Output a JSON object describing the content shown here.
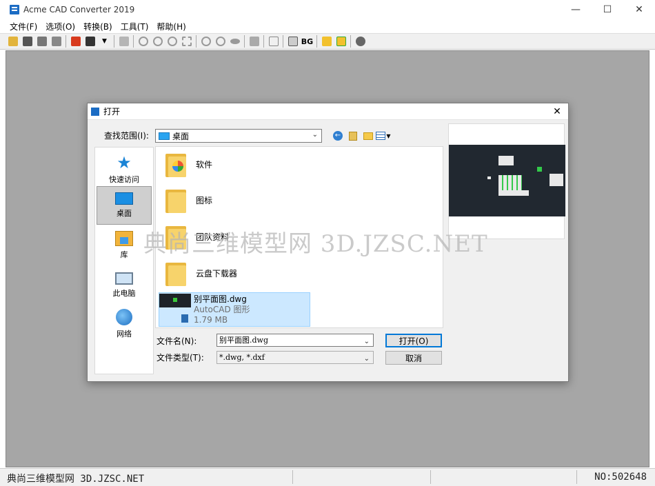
{
  "app": {
    "title": "Acme CAD Converter 2019",
    "controls": {
      "minimize": "—",
      "maximize": "☐",
      "close": "✕"
    }
  },
  "menu": [
    "文件(F)",
    "选项(O)",
    "转换(B)",
    "工具(T)",
    "帮助(H)"
  ],
  "toolbar": {
    "bg_label": "BG"
  },
  "dialog": {
    "title": "打开",
    "close": "✕",
    "look_in_label": "查找范围(I):",
    "look_in_value": "桌面",
    "places": [
      {
        "label": "快速访问",
        "icon": "star-icon"
      },
      {
        "label": "桌面",
        "icon": "desktop-icon"
      },
      {
        "label": "库",
        "icon": "library-icon"
      },
      {
        "label": "此电脑",
        "icon": "computer-icon"
      },
      {
        "label": "网络",
        "icon": "network-icon"
      }
    ],
    "files": [
      {
        "name": "软件",
        "type": "folder"
      },
      {
        "name": "图标",
        "type": "folder"
      },
      {
        "name": "团队资料",
        "type": "folder"
      },
      {
        "name": "云盘下载器",
        "type": "folder"
      },
      {
        "name": "别平面图.dwg",
        "type": "AutoCAD 图形",
        "size": "1.79 MB",
        "selected": true
      }
    ],
    "file_name_label": "文件名(N):",
    "file_name_value": "别平面图.dwg",
    "file_type_label": "文件类型(T):",
    "file_type_value": "*.dwg, *.dxf",
    "open_button": "打开(O)",
    "cancel_button": "取消"
  },
  "watermark": "典尚三维模型网 3D.JZSC.NET",
  "status": {
    "left": "典尚三维模型网 3D.JZSC.NET",
    "right": "NO:502648"
  },
  "colors": {
    "accent": "#0078d7",
    "workspace": "#a6a6a6",
    "selection": "#cce8ff"
  }
}
